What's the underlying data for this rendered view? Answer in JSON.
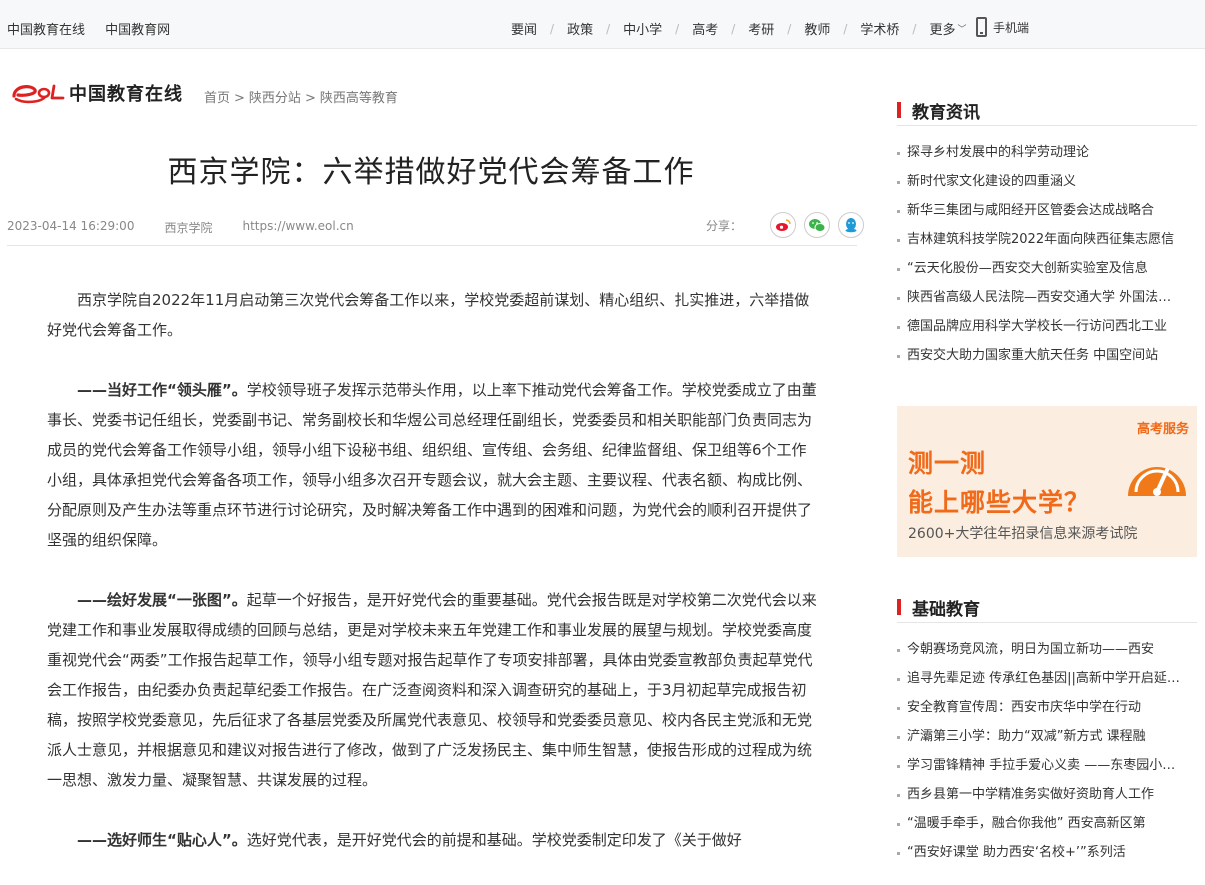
{
  "topbar": {
    "site_links": [
      "中国教育在线",
      "中国教育网"
    ],
    "nav": [
      "要闻",
      "政策",
      "中小学",
      "高考",
      "考研",
      "教师",
      "学术桥"
    ],
    "more": "更多",
    "mobile": "手机端"
  },
  "logo": {
    "mark": "eol",
    "text": "中国教育在线"
  },
  "breadcrumb": [
    "首页",
    "陕西分站",
    "陕西高等教育"
  ],
  "article": {
    "title": "西京学院：六举措做好党代会筹备工作",
    "date": "2023-04-14 16:29:00",
    "source": "西京学院",
    "url": "https://www.eol.cn",
    "share_label": "分享：",
    "paragraphs": [
      {
        "lead": "",
        "text": "西京学院自2022年11月启动第三次党代会筹备工作以来，学校党委超前谋划、精心组织、扎实推进，六举措做好党代会筹备工作。"
      },
      {
        "lead": "——当好工作“领头雁”。",
        "text": "学校领导班子发挥示范带头作用，以上率下推动党代会筹备工作。学校党委成立了由董事长、党委书记任组长，党委副书记、常务副校长和华煜公司总经理任副组长，党委委员和相关职能部门负责同志为成员的党代会筹备工作领导小组，领导小组下设秘书组、组织组、宣传组、会务组、纪律监督组、保卫组等6个工作小组，具体承担党代会筹备各项工作，领导小组多次召开专题会议，就大会主题、主要议程、代表名额、构成比例、分配原则及产生办法等重点环节进行讨论研究，及时解决筹备工作中遇到的困难和问题，为党代会的顺利召开提供了坚强的组织保障。"
      },
      {
        "lead": "——绘好发展“一张图”。",
        "text": "起草一个好报告，是开好党代会的重要基础。党代会报告既是对学校第二次党代会以来党建工作和事业发展取得成绩的回顾与总结，更是对学校未来五年党建工作和事业发展的展望与规划。学校党委高度重视党代会“两委”工作报告起草工作，领导小组专题对报告起草作了专项安排部署，具体由党委宣教部负责起草党代会工作报告，由纪委办负责起草纪委工作报告。在广泛查阅资料和深入调查研究的基础上，于3月初起草完成报告初稿，按照学校党委意见，先后征求了各基层党委及所属党代表意见、校领导和党委委员意见、校内各民主党派和无党派人士意见，并根据意见和建议对报告进行了修改，做到了广泛发扬民主、集中师生智慧，使报告形成的过程成为统一思想、激发力量、凝聚智慧、共谋发展的过程。"
      },
      {
        "lead": "——选好师生“贴心人”。",
        "text": "选好党代表，是开好党代会的前提和基础。学校党委制定印发了《关于做好"
      }
    ]
  },
  "sidebar": {
    "news_title": "教育资讯",
    "news": [
      "探寻乡村发展中的科学劳动理论",
      "新时代家文化建设的四重涵义",
      "新华三集团与咸阳经开区管委会达成战略合",
      "吉林建筑科技学院2022年面向陕西征集志愿信",
      "“云天化股份—西安交大创新实验室及信息",
      "陕西省高级人民法院—西安交通大学 外国法…",
      "德国品牌应用科学大学校长一行访问西北工业",
      "西安交大助力国家重大航天任务 中国空间站"
    ],
    "ad": {
      "tag": "高考服务",
      "line1": "测一测",
      "line2": "能上哪些大学？",
      "sub": "2600+大学往年招录信息来源考试院"
    },
    "basic_title": "基础教育",
    "basic": [
      "今朝赛场竞风流，明日为国立新功——西安",
      "追寻先辈足迹 传承红色基因||高新中学开启延…",
      "安全教育宣传周：西安市庆华中学在行动",
      "浐灞第三小学：助力“双减”新方式 课程融",
      "学习雷锋精神 手拉手爱心义卖 ——东枣园小…",
      "西乡县第一中学精准务实做好资助育人工作",
      "“温暖手牵手，融合你我他” 西安高新区第",
      "“西安好课堂 助力西安‘名校+’”系列活"
    ]
  },
  "colors": {
    "accent_red": "#dd2222",
    "ad_orange": "#f06a1a",
    "ad_bg": "#fbeee0"
  }
}
